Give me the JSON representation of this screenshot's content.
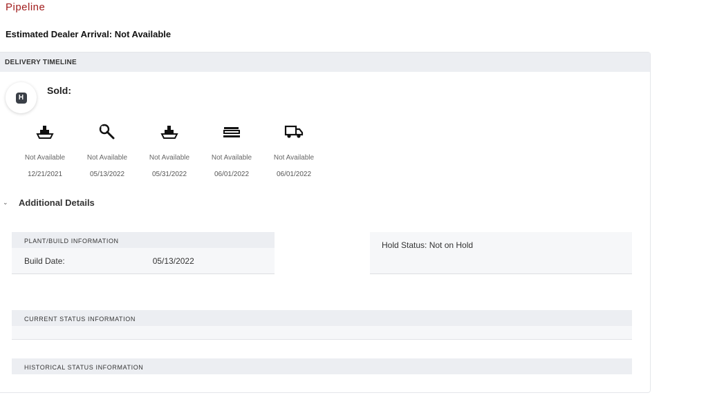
{
  "page": {
    "title": "Pipeline",
    "eta": "Estimated Dealer Arrival: Not Available"
  },
  "timeline": {
    "header": "DELIVERY TIMELINE",
    "sold_badge_letter": "H",
    "sold_label": "Sold:",
    "steps": [
      {
        "icon": "ship-icon",
        "status": "Not Available",
        "date": "12/21/2021"
      },
      {
        "icon": "wrench-icon",
        "status": "Not Available",
        "date": "05/13/2022"
      },
      {
        "icon": "ship-icon",
        "status": "Not Available",
        "date": "05/31/2022"
      },
      {
        "icon": "railcar-icon",
        "status": "Not Available",
        "date": "06/01/2022"
      },
      {
        "icon": "truck-icon",
        "status": "Not Available",
        "date": "06/01/2022"
      }
    ]
  },
  "additional": {
    "label": "Additional Details",
    "plant": {
      "header": "PLANT/BUILD INFORMATION",
      "build_date_label": "Build Date:",
      "build_date_value": "05/13/2022"
    },
    "hold_status": "Hold Status: Not on Hold",
    "current_header": "CURRENT STATUS INFORMATION",
    "historical_header": "HISTORICAL STATUS INFORMATION"
  },
  "colors": {
    "title": "#a11d1d",
    "header_bg": "#eceef2",
    "panel_bg": "#f6f7f9"
  }
}
